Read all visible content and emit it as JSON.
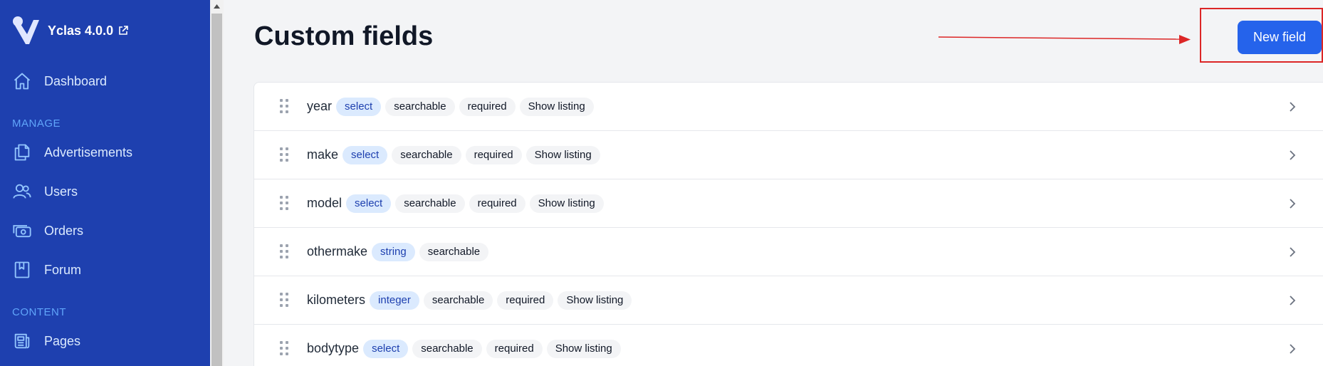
{
  "brand": {
    "name": "Yclas 4.0.0"
  },
  "sidebar": {
    "items": [
      {
        "label": "Dashboard",
        "icon": "home-icon"
      },
      {
        "label": "Advertisements",
        "icon": "documents-icon"
      },
      {
        "label": "Users",
        "icon": "users-icon"
      },
      {
        "label": "Orders",
        "icon": "cash-icon"
      },
      {
        "label": "Forum",
        "icon": "book-icon"
      },
      {
        "label": "Pages",
        "icon": "newspaper-icon"
      }
    ],
    "sections": {
      "manage": "MANAGE",
      "content": "CONTENT"
    }
  },
  "header": {
    "title": "Custom fields",
    "new_button": "New field"
  },
  "fields": [
    {
      "name": "year",
      "type": "select",
      "searchable": "searchable",
      "required": "required",
      "listing": "Show listing"
    },
    {
      "name": "make",
      "type": "select",
      "searchable": "searchable",
      "required": "required",
      "listing": "Show listing"
    },
    {
      "name": "model",
      "type": "select",
      "searchable": "searchable",
      "required": "required",
      "listing": "Show listing"
    },
    {
      "name": "othermake",
      "type": "string",
      "searchable": "searchable"
    },
    {
      "name": "kilometers",
      "type": "integer",
      "searchable": "searchable",
      "required": "required",
      "listing": "Show listing"
    },
    {
      "name": "bodytype",
      "type": "select",
      "searchable": "searchable",
      "required": "required",
      "listing": "Show listing"
    }
  ],
  "colors": {
    "sidebar": "#1e40af",
    "accent": "#2563eb",
    "annotation": "#dc2626"
  }
}
